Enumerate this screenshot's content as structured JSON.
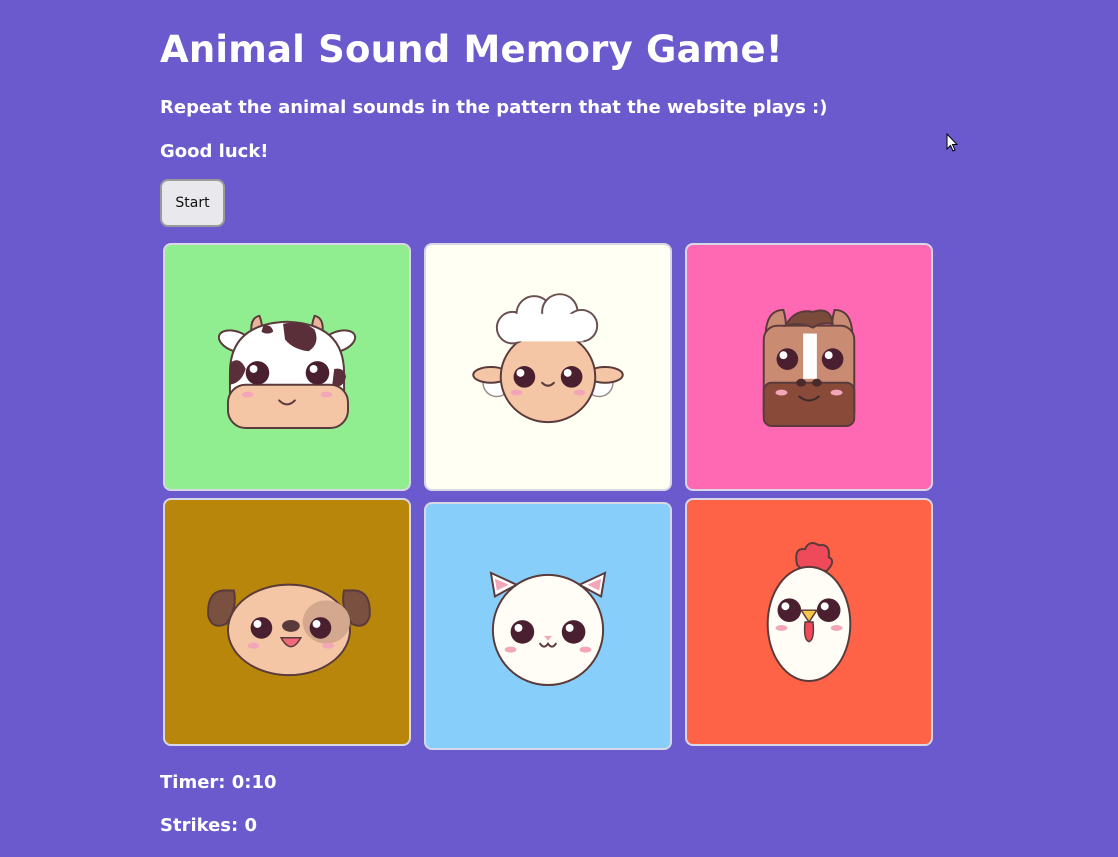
{
  "game": {
    "title": "Animal Sound Memory Game!",
    "instructions": "Repeat the animal sounds in the pattern that the website plays :)",
    "good_luck": "Good luck!",
    "start_label": "Start"
  },
  "tiles": [
    {
      "animal": "cow",
      "icon": "cow-icon",
      "color": "#90ee90"
    },
    {
      "animal": "sheep",
      "icon": "sheep-icon",
      "color": "#fffff3"
    },
    {
      "animal": "horse",
      "icon": "horse-icon",
      "color": "#ff69b4"
    },
    {
      "animal": "dog",
      "icon": "dog-icon",
      "color": "#b8860b"
    },
    {
      "animal": "cat",
      "icon": "cat-icon",
      "color": "#87cefa"
    },
    {
      "animal": "chicken",
      "icon": "chicken-icon",
      "color": "#ff6347"
    }
  ],
  "status": {
    "timer_label": "Timer:",
    "timer_value": "0:10",
    "strikes_label": "Strikes:",
    "strikes_value": "0"
  },
  "colors": {
    "background": "#6b5acd",
    "text": "#ffffff"
  }
}
